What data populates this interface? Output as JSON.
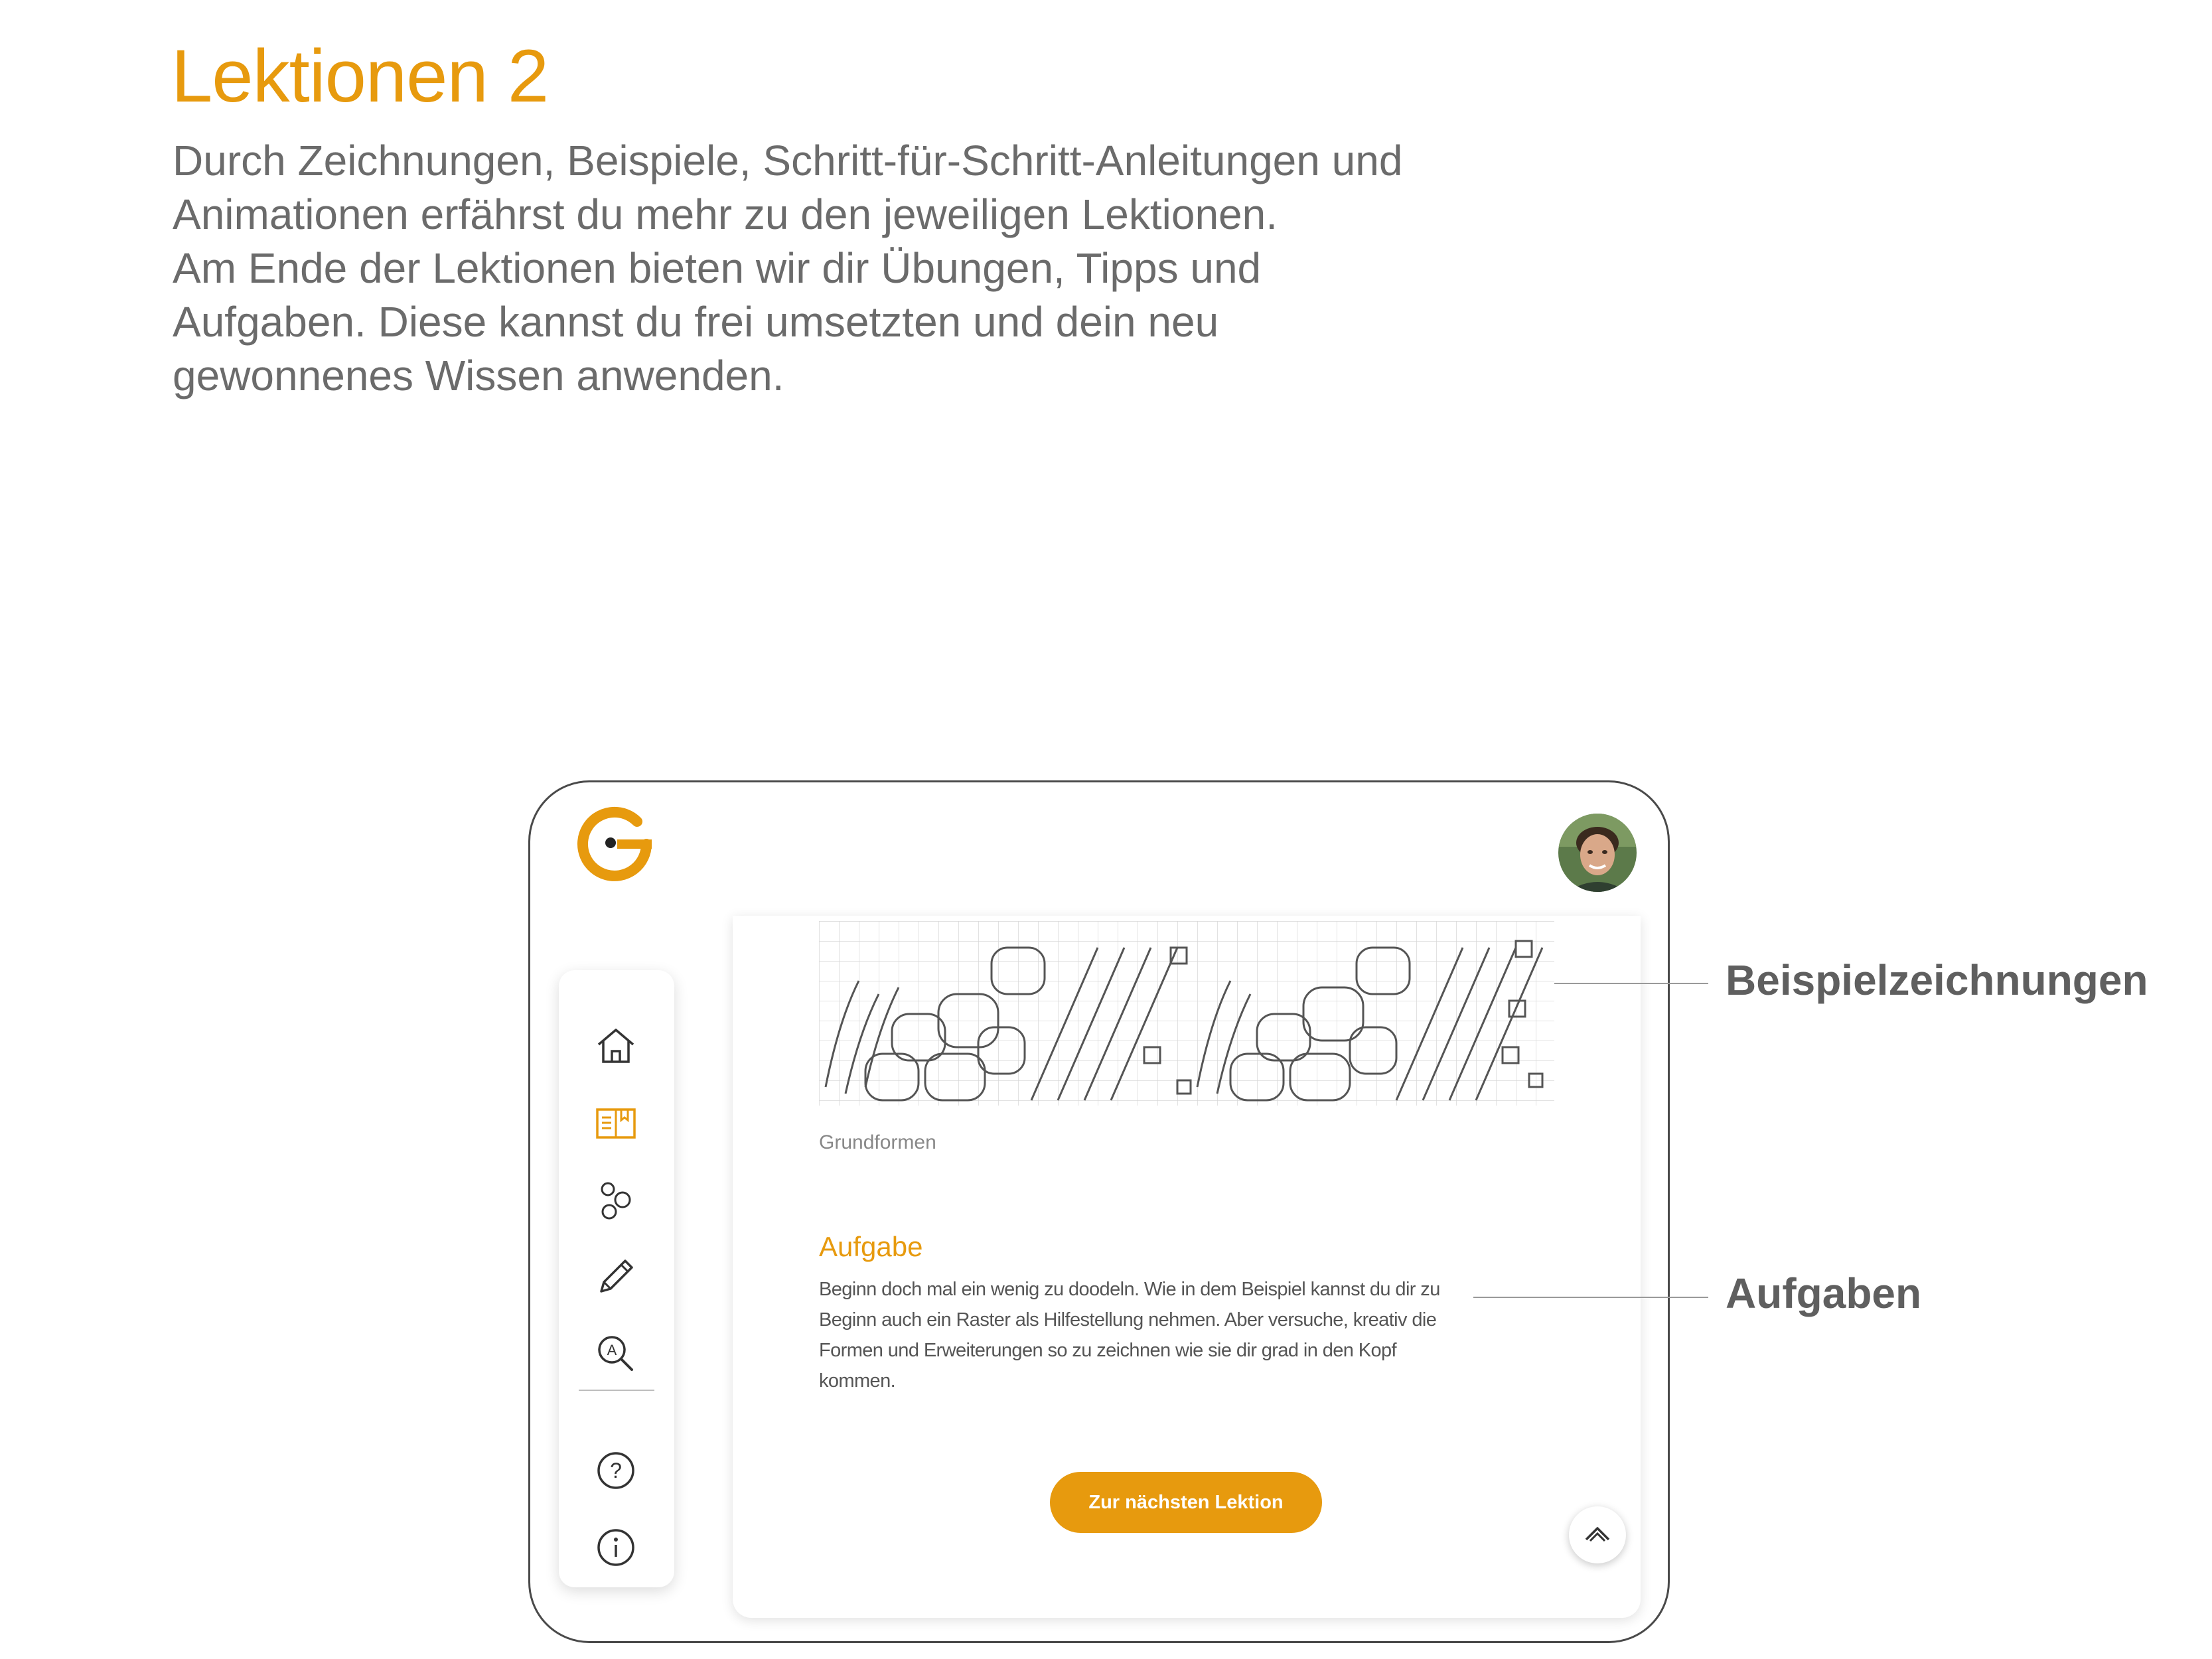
{
  "page": {
    "title": "Lektionen 2",
    "intro_paragraphs": [
      "Durch Zeichnungen, Beispiele, Schritt-für-Schritt-Anleitungen und Animationen erfährst du mehr zu den jeweiligen Lektionen.",
      "Am Ende der Lektionen bieten wir dir Übungen, Tipps und Aufgaben. Diese kannst du frei umsetzten und dein neu gewonnenes Wissen anwenden."
    ]
  },
  "app": {
    "logo_icon": "g-logo-icon",
    "accent_color": "#e79a0e",
    "sidebar": {
      "items": [
        {
          "icon": "home-icon",
          "active": false
        },
        {
          "icon": "book-icon",
          "active": true
        },
        {
          "icon": "shapes-icon",
          "active": false
        },
        {
          "icon": "pencil-icon",
          "active": false
        },
        {
          "icon": "search-letter-icon",
          "active": false
        },
        {
          "icon": "help-icon",
          "active": false
        },
        {
          "icon": "info-icon",
          "active": false
        }
      ]
    },
    "content": {
      "image_caption": "Grundformen",
      "task_title": "Aufgabe",
      "task_text": "Beginn doch mal ein wenig zu doodeln. Wie in dem Beispiel kannst du dir zu Beginn auch ein Raster als Hilfestellung nehmen. Aber versuche, kreativ die Formen und Erweiterungen so zu zeichnen wie sie dir grad in den Kopf kommen.",
      "next_button": "Zur nächsten Lektion"
    }
  },
  "callouts": {
    "examples": "Beispielzeichnungen",
    "tasks": "Aufgaben"
  }
}
